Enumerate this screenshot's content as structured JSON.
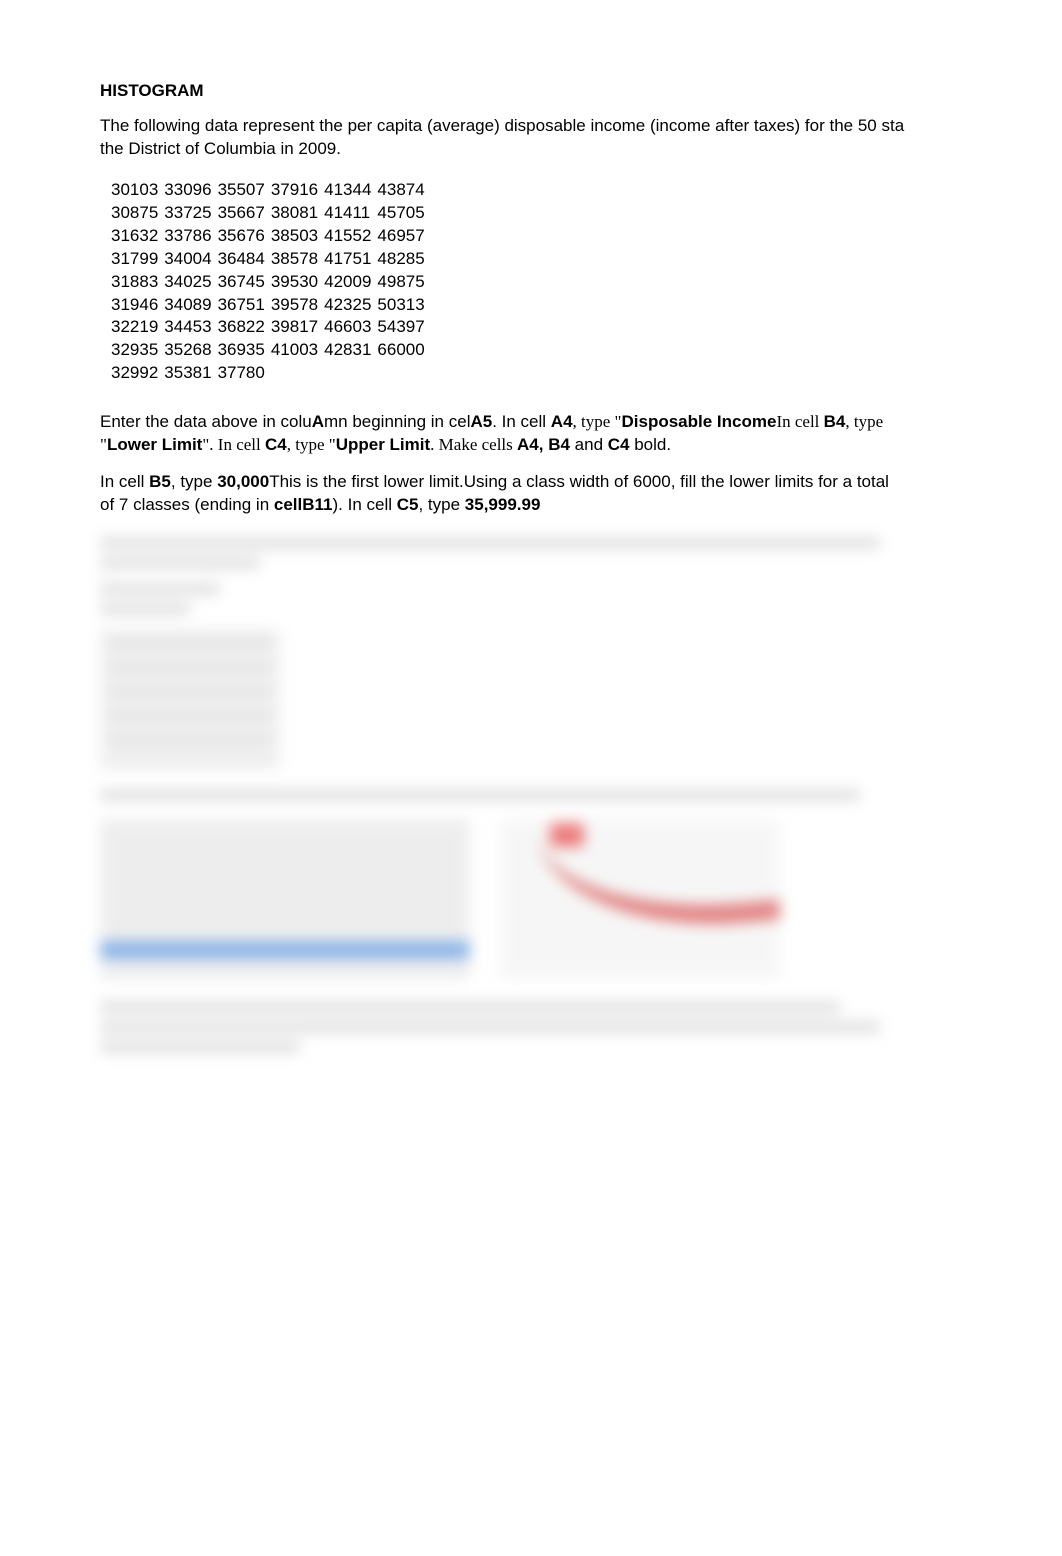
{
  "heading": "HISTOGRAM",
  "intro_line1": "The following data represent the per capita (average) disposable income (income after taxes) for the 50 sta",
  "intro_line2": "the District of Columbia in 2009.",
  "data_rows": [
    [
      "30103",
      "33096",
      "35507",
      "37916",
      "41344",
      "43874"
    ],
    [
      "30875",
      "33725",
      "35667",
      "38081",
      "41411",
      "45705"
    ],
    [
      "31632",
      "33786",
      "35676",
      "38503",
      "41552",
      "46957"
    ],
    [
      "31799",
      "34004",
      "36484",
      "38578",
      "41751",
      "48285"
    ],
    [
      "31883",
      "34025",
      "36745",
      "39530",
      "42009",
      "49875"
    ],
    [
      "31946",
      "34089",
      "36751",
      "39578",
      "42325",
      "50313"
    ],
    [
      "32219",
      "34453",
      "36822",
      "39817",
      "46603",
      "54397"
    ],
    [
      "32935",
      "35268",
      "36935",
      "41003",
      "42831",
      "66000"
    ],
    [
      "32992",
      "35381",
      "37780",
      "",
      "",
      ""
    ]
  ],
  "p1": {
    "prefix": "Enter the data above in colu",
    "colA": "A",
    "mid1": "mn beginning in cel",
    "cellA5": "A5",
    "mid2": ". In cell ",
    "cellA4": "A4",
    "type1": ", type \"",
    "disposable": "Disposable Income",
    "mid3": "In cell ",
    "cellB4": "B4",
    "type2": ", type",
    "lower": "Lower Limit",
    "mid4": "\". In cell ",
    "cellC4": "C4",
    "type3": ", type \"",
    "upper": "Upper Limit",
    "mid5": ". Make cells ",
    "cellsA4B4": "A4, B4",
    "and": " and ",
    "cellC4_2": "C4",
    "bold": " bold."
  },
  "p2": {
    "prefix": "In cell ",
    "cellB5": "B5",
    "type1": ", type ",
    "val30000": "30,000",
    "mid1": "This is the first lower limit.Using a class width of 6000, fill the lower limits for a total",
    "line2a": "of 7 classes (ending in ",
    "cellB11": "cell",
    "cellB11b": "B11",
    "line2b": "). In cell ",
    "cellC5": "C5",
    "type2": ", type ",
    "val35999": "35,999.99"
  }
}
